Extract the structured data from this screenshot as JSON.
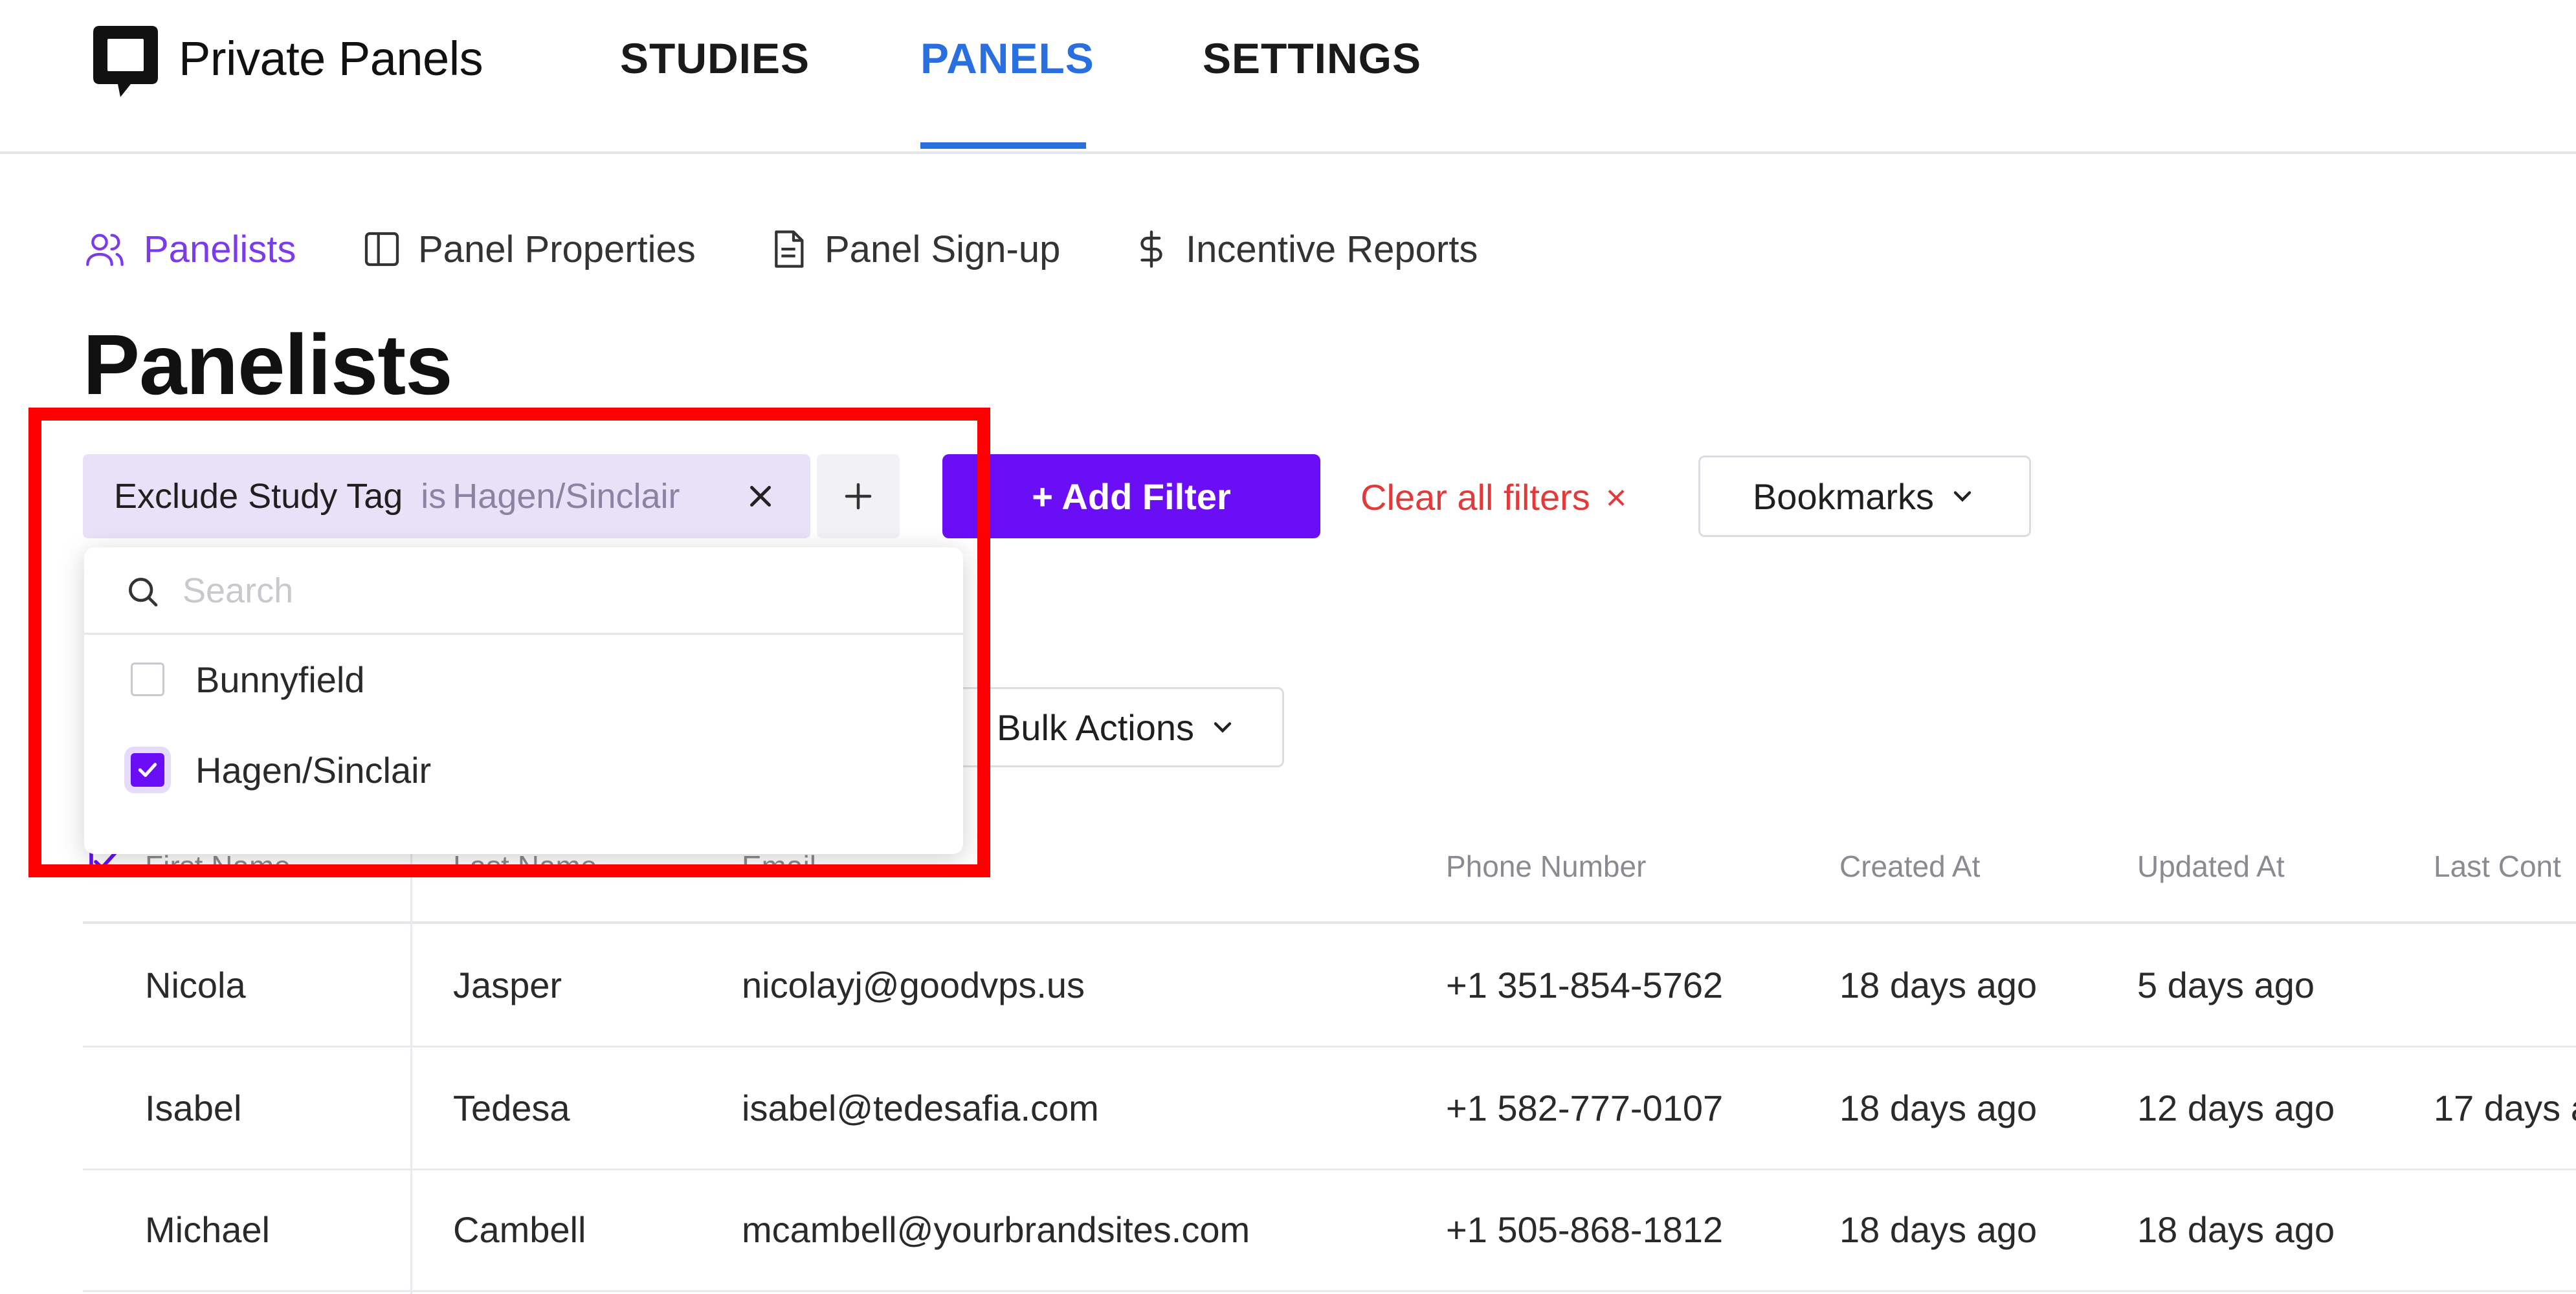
{
  "app": {
    "title": "Private Panels"
  },
  "nav": {
    "tabs": [
      {
        "label": "STUDIES"
      },
      {
        "label": "PANELS"
      },
      {
        "label": "SETTINGS"
      }
    ],
    "active": "PANELS"
  },
  "subnav": {
    "items": [
      {
        "label": "Panelists",
        "icon": "users-icon"
      },
      {
        "label": "Panel Properties",
        "icon": "columns-icon"
      },
      {
        "label": "Panel Sign-up",
        "icon": "document-icon"
      },
      {
        "label": "Incentive Reports",
        "icon": "dollar-icon"
      }
    ],
    "active": "Panelists"
  },
  "page": {
    "title": "Panelists"
  },
  "filters": {
    "chip": {
      "label": "Exclude Study Tag",
      "operator": "is",
      "value": "Hagen/Sinclair"
    },
    "add_filter_label": "+ Add Filter",
    "clear_all_label": "Clear all filters",
    "clear_all_icon": "×",
    "bookmarks_label": "Bookmarks",
    "bulk_actions_label": "Bulk Actions"
  },
  "dropdown": {
    "search_placeholder": "Search",
    "options": [
      {
        "label": "Bunnyfield",
        "checked": false
      },
      {
        "label": "Hagen/Sinclair",
        "checked": true
      }
    ]
  },
  "table": {
    "columns": [
      "First Name",
      "Last Name",
      "Email",
      "Phone Number",
      "Created At",
      "Updated At",
      "Last Cont"
    ],
    "rows": [
      {
        "first": "Nicola",
        "last": "Jasper",
        "email": "nicolayj@goodvps.us",
        "phone": "+1 351-854-5762",
        "created": "18 days ago",
        "updated": "5 days ago",
        "last_contact": ""
      },
      {
        "first": "Isabel",
        "last": "Tedesa",
        "email": "isabel@tedesafia.com",
        "phone": "+1 582-777-0107",
        "created": "18 days ago",
        "updated": "12 days ago",
        "last_contact": "17 days a"
      },
      {
        "first": "Michael",
        "last": "Cambell",
        "email": "mcambell@yourbrandsites.com",
        "phone": "+1 505-868-1812",
        "created": "18 days ago",
        "updated": "18 days ago",
        "last_contact": ""
      }
    ]
  },
  "colors": {
    "primary": "#6a0ff5",
    "nav_active": "#2a6fe0",
    "subnav_active": "#7c3aed",
    "danger": "#e23a3a",
    "chip_bg": "#e9e1f8",
    "annotation": "#ff0000"
  }
}
